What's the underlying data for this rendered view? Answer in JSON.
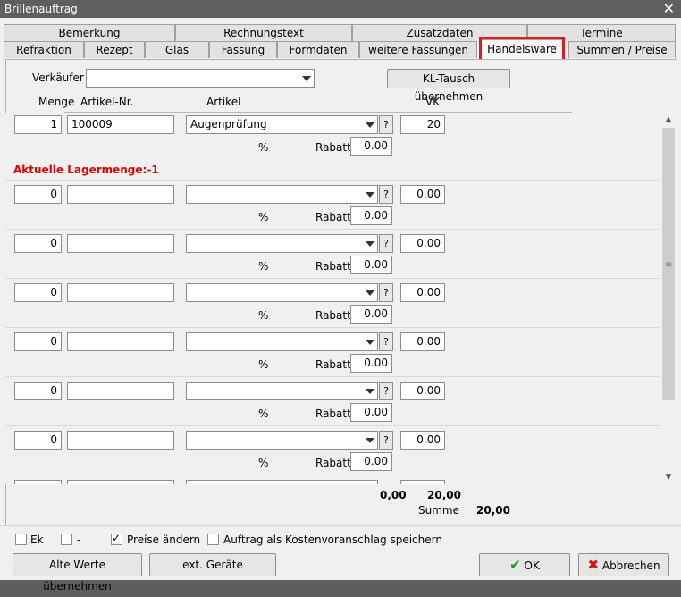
{
  "window": {
    "title": "Brillenauftrag",
    "close": "✕"
  },
  "tabs_row1": [
    "Bemerkung",
    "Rechnungstext",
    "Zusatzdaten",
    "Termine"
  ],
  "tabs_row2": [
    "Refraktion",
    "Rezept",
    "Glas",
    "Fassung",
    "Formdaten",
    "weitere Fassungen",
    "Handelsware",
    "Summen / Preise"
  ],
  "header": {
    "verkaeufer_label": "Verkäufer",
    "verkaeufer_value": "",
    "kl_button": "KL-Tausch übernehmen",
    "col_menge": "Menge",
    "col_artikelnr": "Artikel-Nr.",
    "col_artikel": "Artikel",
    "col_vk": "VK"
  },
  "rows": [
    {
      "menge": "1",
      "artikelnr": "100009",
      "artikel": "Augenprüfung",
      "vk": "20",
      "percent": "%",
      "rabatt_label": "Rabatt",
      "rabatt": "0.00",
      "help": "?"
    },
    {
      "menge": "0",
      "artikelnr": "",
      "artikel": "",
      "vk": "0.00",
      "percent": "%",
      "rabatt_label": "Rabatt",
      "rabatt": "0.00",
      "help": "?"
    },
    {
      "menge": "0",
      "artikelnr": "",
      "artikel": "",
      "vk": "0.00",
      "percent": "%",
      "rabatt_label": "Rabatt",
      "rabatt": "0.00",
      "help": "?"
    },
    {
      "menge": "0",
      "artikelnr": "",
      "artikel": "",
      "vk": "0.00",
      "percent": "%",
      "rabatt_label": "Rabatt",
      "rabatt": "0.00",
      "help": "?"
    },
    {
      "menge": "0",
      "artikelnr": "",
      "artikel": "",
      "vk": "0.00",
      "percent": "%",
      "rabatt_label": "Rabatt",
      "rabatt": "0.00",
      "help": "?"
    },
    {
      "menge": "0",
      "artikelnr": "",
      "artikel": "",
      "vk": "0.00",
      "percent": "%",
      "rabatt_label": "Rabatt",
      "rabatt": "0.00",
      "help": "?"
    },
    {
      "menge": "0",
      "artikelnr": "",
      "artikel": "",
      "vk": "0.00",
      "percent": "%",
      "rabatt_label": "Rabatt",
      "rabatt": "0.00",
      "help": "?"
    }
  ],
  "warning": "Aktuelle Lagermenge:-1",
  "warning_color": "#e00000",
  "totals": {
    "left": "0,00",
    "right": "20,00",
    "summe_label": "Summe",
    "summe": "20,00"
  },
  "options": [
    {
      "label": "Ek",
      "checked": false
    },
    {
      "label": "-",
      "checked": false
    },
    {
      "label": "Preise ändern",
      "checked": true
    },
    {
      "label": "Auftrag als Kostenvoranschlag speichern",
      "checked": false
    }
  ],
  "buttons": {
    "alte_werte": "Alte Werte übernehmen",
    "ext_geraete": "ext. Geräte",
    "ok": "OK",
    "abbrechen": "Abbrechen"
  },
  "colors": {
    "highlight": "#e11b22",
    "ok_icon": "#1a9a1a",
    "cancel_icon": "#d01818"
  }
}
